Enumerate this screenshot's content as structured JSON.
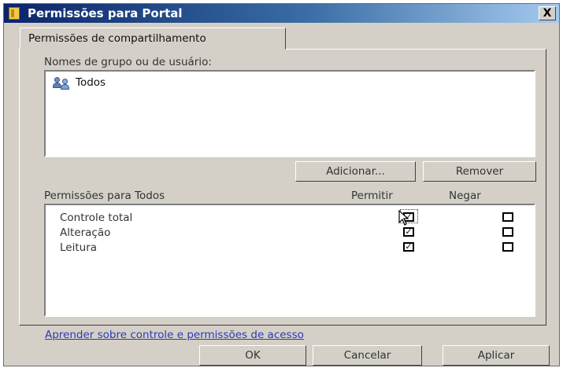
{
  "window": {
    "title": "Permissões para Portal",
    "close_label": "X"
  },
  "tab": {
    "label": "Permissões de compartilhamento"
  },
  "groups": {
    "label": "Nomes de grupo ou de usuário:",
    "items": [
      {
        "name": "Todos",
        "icon": "users-group-icon"
      }
    ],
    "add_button": "Adicionar...",
    "remove_button": "Remover"
  },
  "permissions": {
    "label": "Permissões para Todos",
    "allow_header": "Permitir",
    "deny_header": "Negar",
    "rows": [
      {
        "name": "Controle total",
        "allow": true,
        "deny": false
      },
      {
        "name": "Alteração",
        "allow": true,
        "deny": false
      },
      {
        "name": "Leitura",
        "allow": true,
        "deny": false
      }
    ]
  },
  "link": "Aprender sobre controle e permissões de acesso",
  "buttons": {
    "ok": "OK",
    "cancel": "Cancelar",
    "apply": "Aplicar"
  },
  "colors": {
    "title_bar": "#0a246a",
    "dialog": "#d4d0c8",
    "link": "#2a3bb0"
  }
}
